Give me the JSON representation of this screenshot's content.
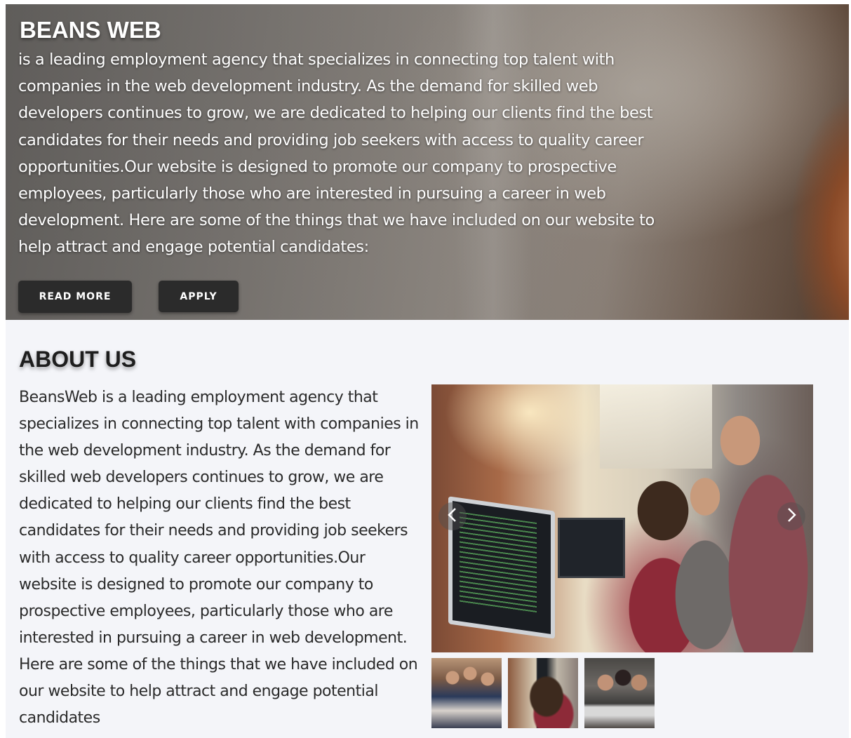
{
  "hero": {
    "title": "BEANS WEB",
    "description": "is a leading employment agency that specializes in connecting top talent with companies in the web development industry. As the demand for skilled web developers continues to grow, we are dedicated to helping our clients find the best candidates for their needs and providing job seekers with access to quality career opportunities.Our website is designed to promote our company to prospective employees, particularly those who are interested in pursuing a career in web development. Here are some of the things that we have included on our website to help attract and engage potential candidates:",
    "read_more_label": "READ MORE",
    "apply_label": "APPLY"
  },
  "about": {
    "title": "ABOUT US",
    "description": "BeansWeb is a leading employment agency that specializes in connecting top talent with companies in the web development industry. As the demand for skilled web developers continues to grow, we are dedicated to helping our clients find the best candidates for their needs and providing job seekers with access to quality career opportunities.Our website is designed to promote our company to prospective employees, particularly those who are interested in pursuing a career in web development. Here are some of the things that we have included on our website to help attract and engage potential candidates"
  },
  "carousel": {
    "prev_icon": "chevron-left-icon",
    "next_icon": "chevron-right-icon",
    "thumbnail_count": 3
  },
  "colors": {
    "button_bg": "#2b2b2b",
    "section_bg": "#f4f5f9",
    "heading_text": "#1e1e1e"
  }
}
